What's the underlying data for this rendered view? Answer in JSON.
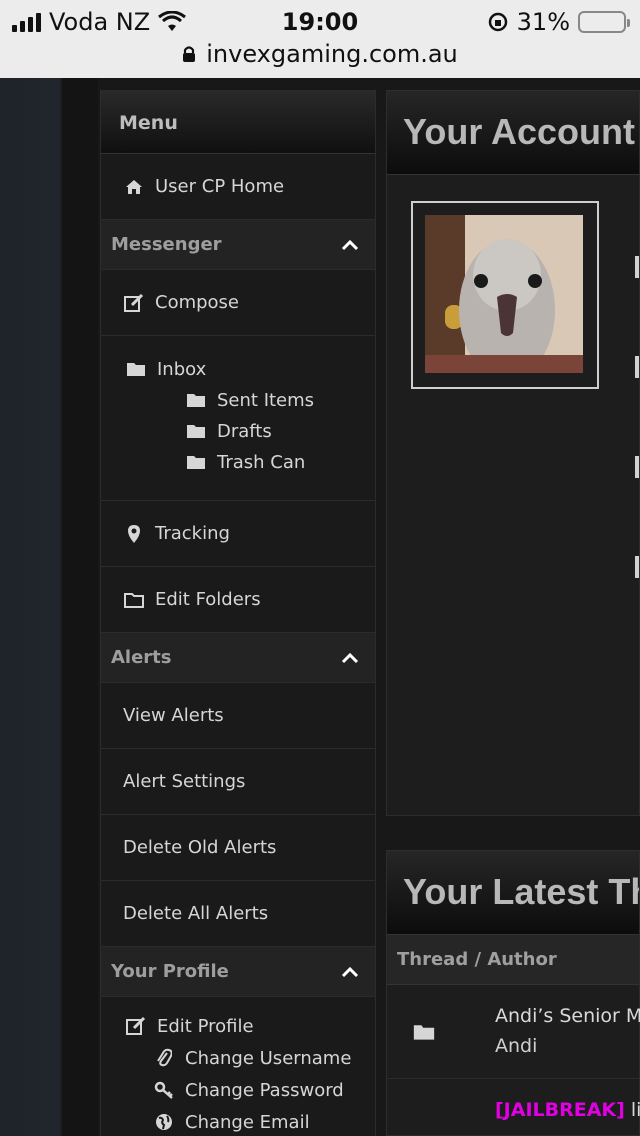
{
  "status_bar": {
    "carrier": "Voda NZ",
    "time": "19:00",
    "battery": "31%",
    "battery_level": 0.31,
    "url": "invexgaming.com.au"
  },
  "sidebar": {
    "menu_title": "Menu",
    "home": {
      "label": "User CP Home",
      "icon": "home-icon"
    },
    "messenger": {
      "title": "Messenger",
      "compose": "Compose",
      "inbox": "Inbox",
      "sent": "Sent Items",
      "drafts": "Drafts",
      "trash": "Trash Can",
      "tracking": "Tracking",
      "edit_folders": "Edit Folders"
    },
    "alerts": {
      "title": "Alerts",
      "view": "View Alerts",
      "settings": "Alert Settings",
      "delete_old": "Delete Old Alerts",
      "delete_all": "Delete All Alerts"
    },
    "profile": {
      "title": "Your Profile",
      "edit": "Edit Profile",
      "change_username": "Change Username",
      "change_password": "Change Password",
      "change_email": "Change Email"
    }
  },
  "main": {
    "account_title": "Your Account S",
    "latest_title": "Your Latest Th",
    "col_header": "Thread / Author",
    "threads": [
      {
        "title": "Andi’s Senior Me",
        "author": "Andi"
      },
      {
        "tag": "[JAILBREAK]",
        "title": " lis"
      }
    ]
  },
  "colors": {
    "accent_tag": "#e100e1",
    "battery": "#f5c400"
  }
}
